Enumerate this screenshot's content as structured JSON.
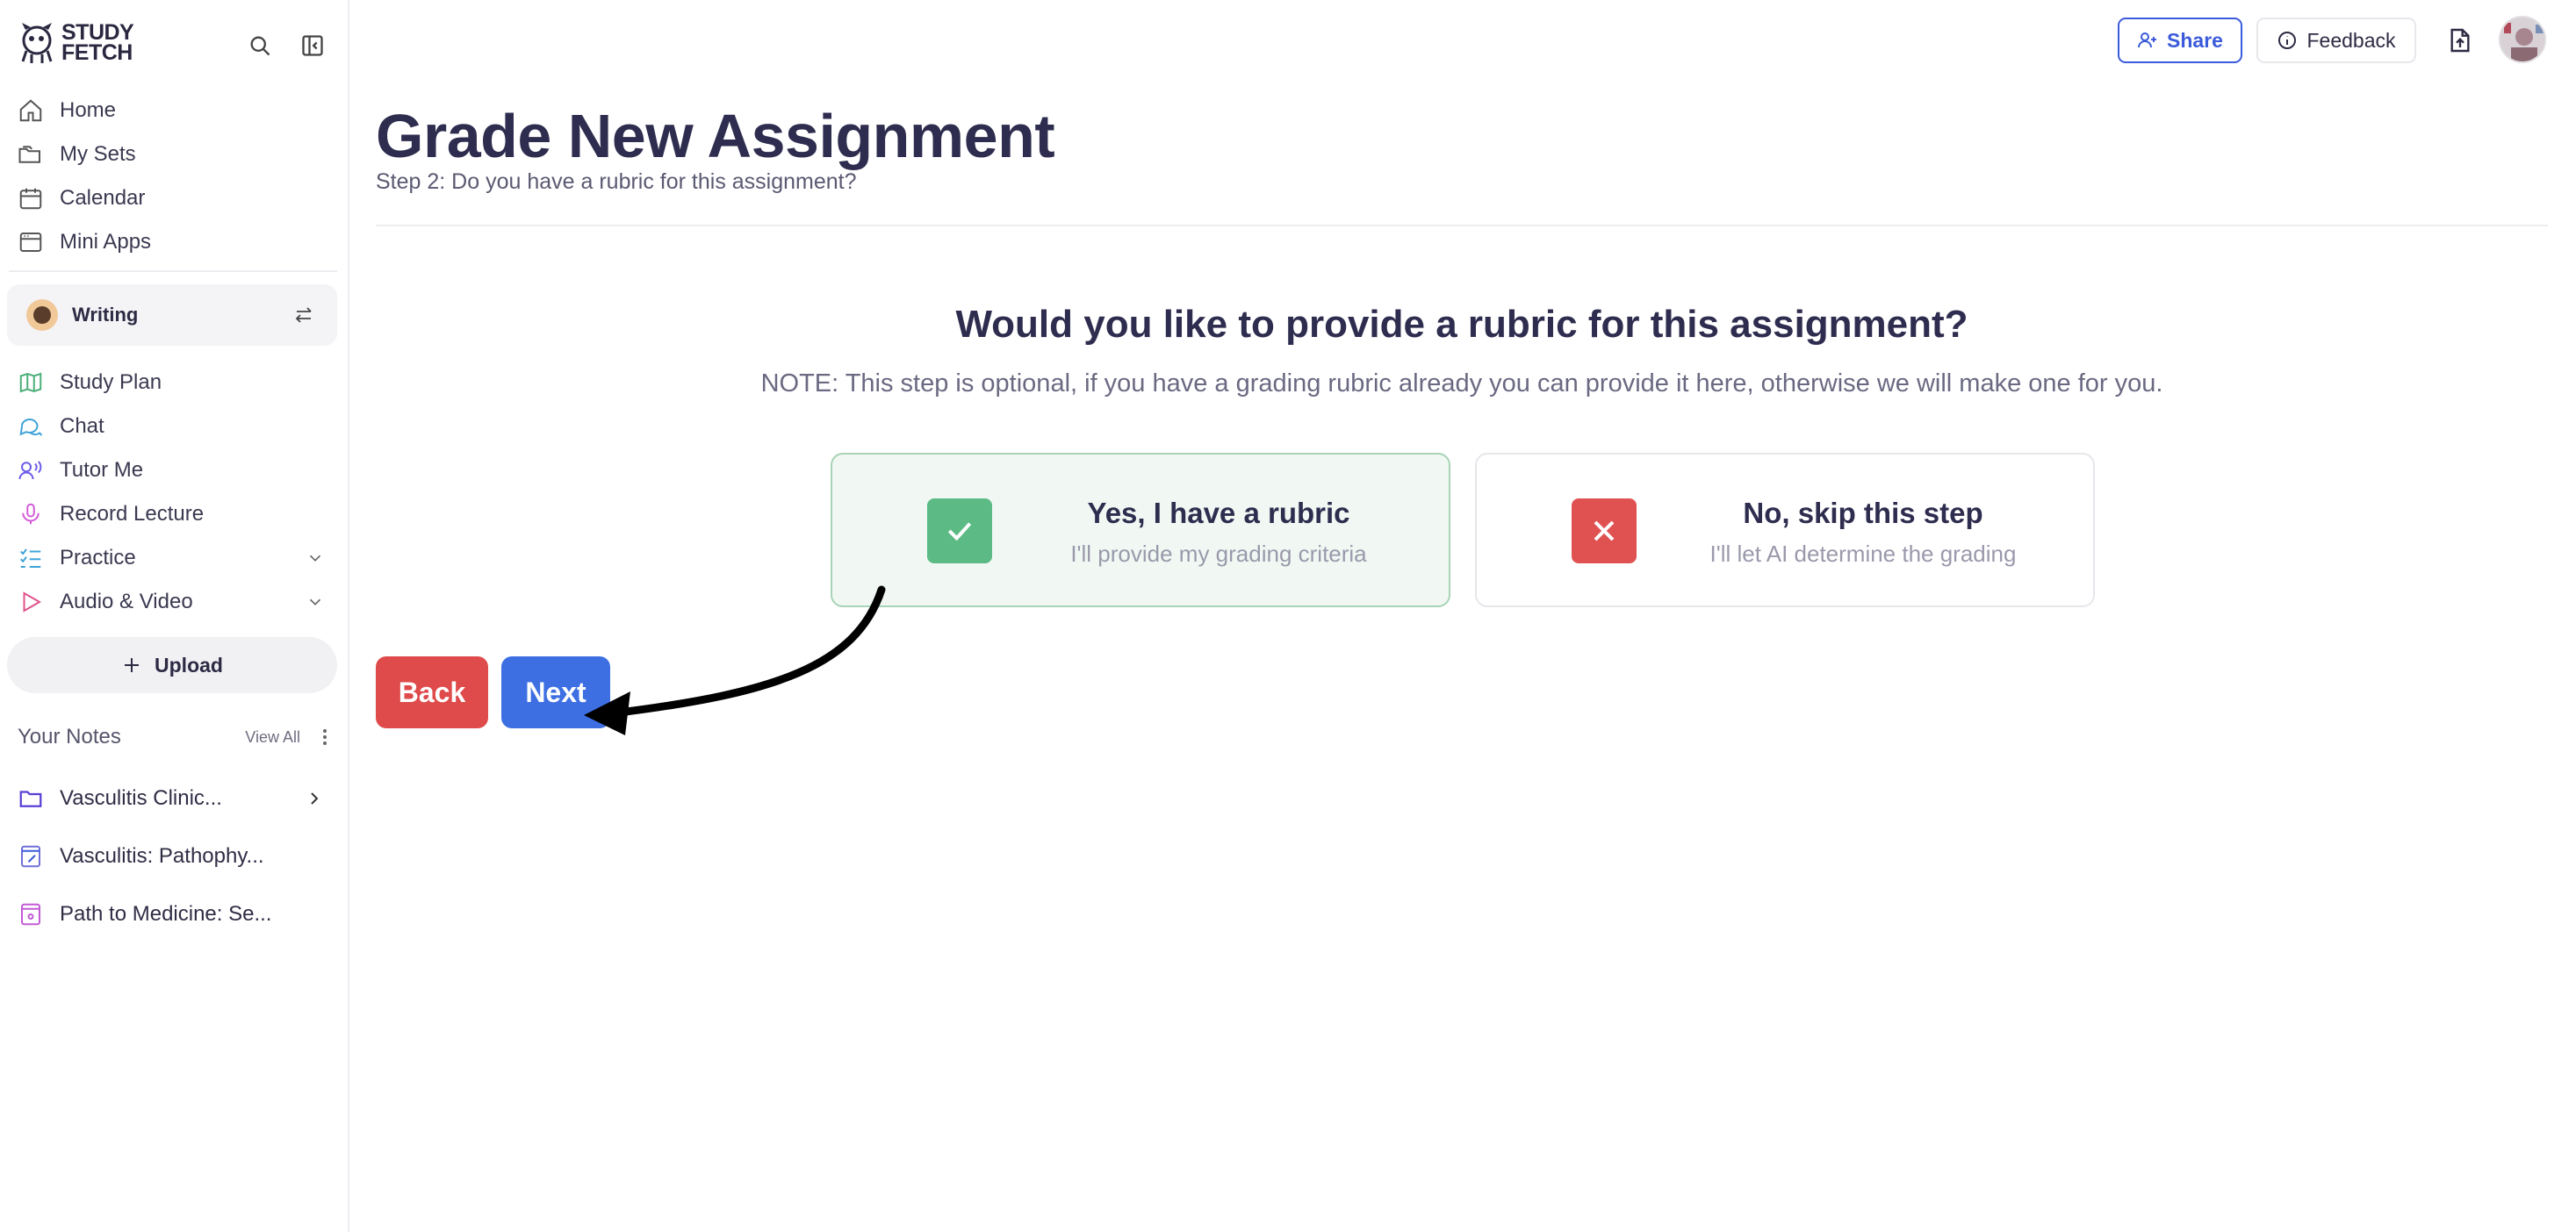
{
  "app": {
    "logo_text": "STUDY FETCH"
  },
  "sidebar": {
    "primary_nav": [
      {
        "label": "Home",
        "icon": "home-icon"
      },
      {
        "label": "My Sets",
        "icon": "folders-icon"
      },
      {
        "label": "Calendar",
        "icon": "calendar-icon"
      },
      {
        "label": "Mini Apps",
        "icon": "app-window-icon"
      }
    ],
    "workspace": {
      "label": "Writing"
    },
    "tools_nav": [
      {
        "label": "Study Plan",
        "icon": "map-icon"
      },
      {
        "label": "Chat",
        "icon": "chat-icon"
      },
      {
        "label": "Tutor Me",
        "icon": "tutor-icon"
      },
      {
        "label": "Record Lecture",
        "icon": "microphone-icon"
      },
      {
        "label": "Practice",
        "icon": "list-check-icon"
      },
      {
        "label": "Audio & Video",
        "icon": "play-icon"
      }
    ],
    "upload_label": "Upload",
    "notes": {
      "title": "Your Notes",
      "view_all": "View All",
      "items": [
        {
          "label": "Vasculitis Clinic...",
          "icon": "folder-icon"
        },
        {
          "label": "Vasculitis: Pathophy...",
          "icon": "note-edit-icon"
        },
        {
          "label": "Path to Medicine: Se...",
          "icon": "note-icon"
        }
      ]
    }
  },
  "header": {
    "share_label": "Share",
    "feedback_label": "Feedback"
  },
  "main": {
    "title": "Grade New Assignment",
    "subtitle": "Step 2: Do you have a rubric for this assignment?",
    "question": "Would you like to provide a rubric for this assignment?",
    "note": "NOTE: This step is optional, if you have a grading rubric already you can provide it here, otherwise we will make one for you.",
    "options": {
      "yes": {
        "title": "Yes, I have a rubric",
        "subtitle": "I'll provide my grading criteria",
        "selected": true
      },
      "no": {
        "title": "No, skip this step",
        "subtitle": "I'll let AI determine the grading",
        "selected": false
      }
    },
    "back_label": "Back",
    "next_label": "Next"
  },
  "colors": {
    "brand_blue": "#3d6fe3",
    "danger_red": "#df4a4a",
    "success_green": "#5cba84",
    "title_text": "#2f2d4f"
  }
}
